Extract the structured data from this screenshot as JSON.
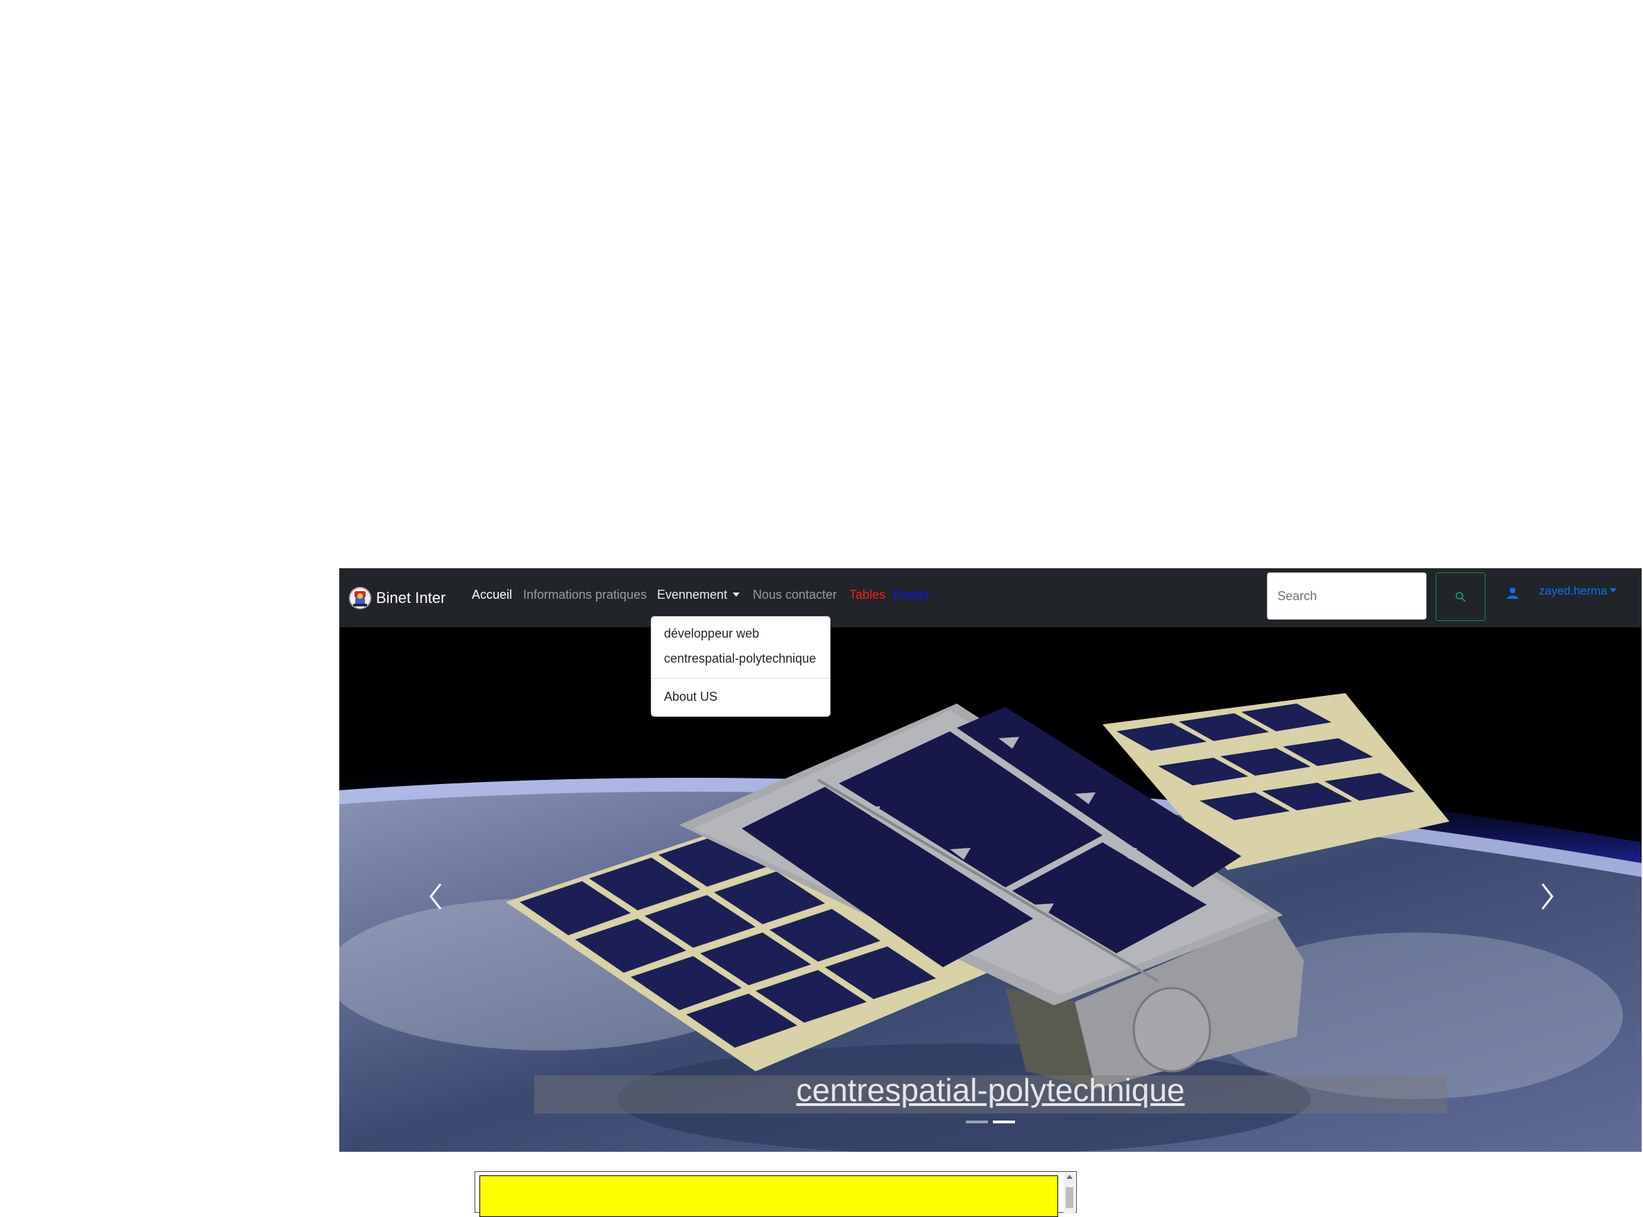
{
  "navbar": {
    "brand": "Binet Inter",
    "links": {
      "accueil": "Accueil",
      "informations": "Informations pratiques",
      "evennement": "Evennement",
      "contact": "Nous contacter",
      "tables": "Tables",
      "poster": "Poster"
    },
    "search": {
      "placeholder": "Search"
    },
    "user": {
      "name": "zayed.herma"
    }
  },
  "dropdown": {
    "items": [
      "développeur web",
      "centrespatial-polytechnique",
      "About US"
    ]
  },
  "carousel": {
    "caption": "centrespatial-polytechnique",
    "slide_count": 2,
    "active_slide": 2
  },
  "colors": {
    "navbar_bg": "#212529",
    "tables_link": "#ff1a1a",
    "poster_link": "#0d11ff",
    "user_link": "#0d6efd",
    "search_button_border": "#198754",
    "frame_fill": "#ffff00"
  }
}
